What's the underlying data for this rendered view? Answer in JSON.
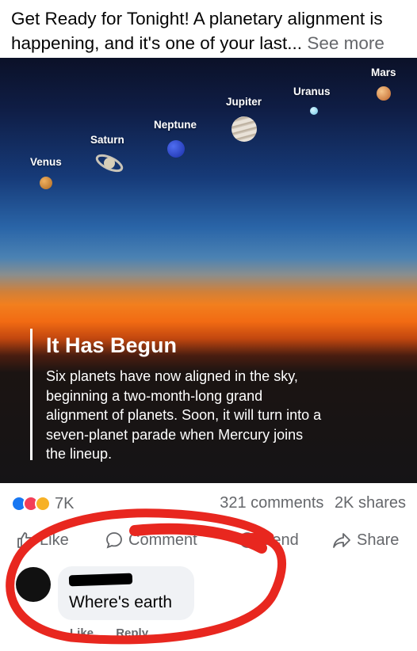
{
  "post": {
    "caption": "Get Ready for Tonight! A planetary alignment is happening, and it's one of your last...",
    "see_more": "See more"
  },
  "image": {
    "planets": [
      {
        "name": "Venus"
      },
      {
        "name": "Saturn"
      },
      {
        "name": "Neptune"
      },
      {
        "name": "Jupiter"
      },
      {
        "name": "Uranus"
      },
      {
        "name": "Mars"
      }
    ],
    "headline": "It Has Begun",
    "body": "Six planets have now aligned in the sky, beginning a two-month-long grand alignment of planets. Soon, it will turn into a seven-planet parade when Mercury joins the lineup."
  },
  "stats": {
    "reactions": "7K",
    "comments": "321 comments",
    "shares": "2K shares"
  },
  "actions": {
    "like": "Like",
    "comment": "Comment",
    "send": "Send",
    "share": "Share"
  },
  "comment": {
    "text": "Where's earth",
    "like": "Like",
    "reply": "Reply"
  },
  "colors": {
    "annotation_red": "#e8271f",
    "facebook_blue": "#1877f2",
    "secondary_text": "#65676b"
  }
}
